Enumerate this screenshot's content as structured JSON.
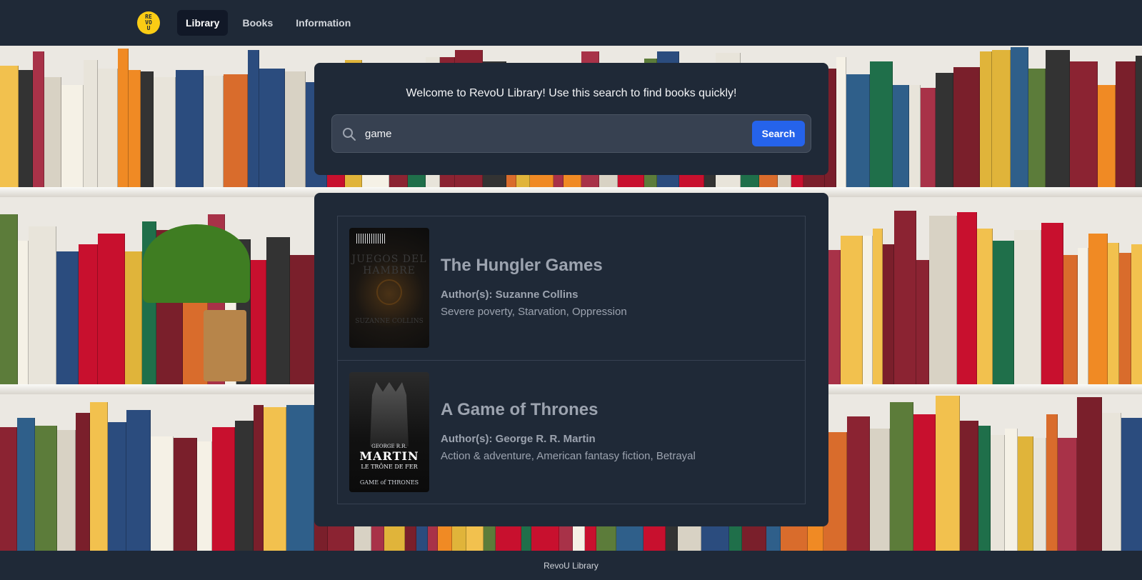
{
  "nav": {
    "logo_text": "RE VO U",
    "links": [
      {
        "label": "Library",
        "active": true
      },
      {
        "label": "Books",
        "active": false
      },
      {
        "label": "Information",
        "active": false
      }
    ]
  },
  "search": {
    "welcome": "Welcome to RevoU Library! Use this search to find books quickly!",
    "value": "game",
    "button_label": "Search",
    "icon": "search-icon"
  },
  "results": [
    {
      "title": "The Hungler Games",
      "author_label": "Author(s):",
      "author": "Suzanne Collins",
      "subjects": "Severe poverty, Starvation, Oppression",
      "cover": {
        "title_text": "JUEGOS DEL HAMBRE",
        "author_text": "SUZANNE COLLINS"
      }
    },
    {
      "title": "A Game of Thrones",
      "author_label": "Author(s):",
      "author": "George R. R. Martin",
      "subjects": "Action & adventure, American fantasy fiction, Betrayal",
      "cover": {
        "small_text": "GEORGE R.R.",
        "name_text": "MARTIN",
        "sub_text": "LE TRÔNE DE FER",
        "logo_text": "GAME of THRONES"
      }
    }
  ],
  "footer": {
    "text": "RevoU Library"
  },
  "colors": {
    "background": "#1f2937",
    "panel": "#1f2937",
    "input": "#374151",
    "accent": "#2563eb",
    "logo": "#facc15"
  }
}
